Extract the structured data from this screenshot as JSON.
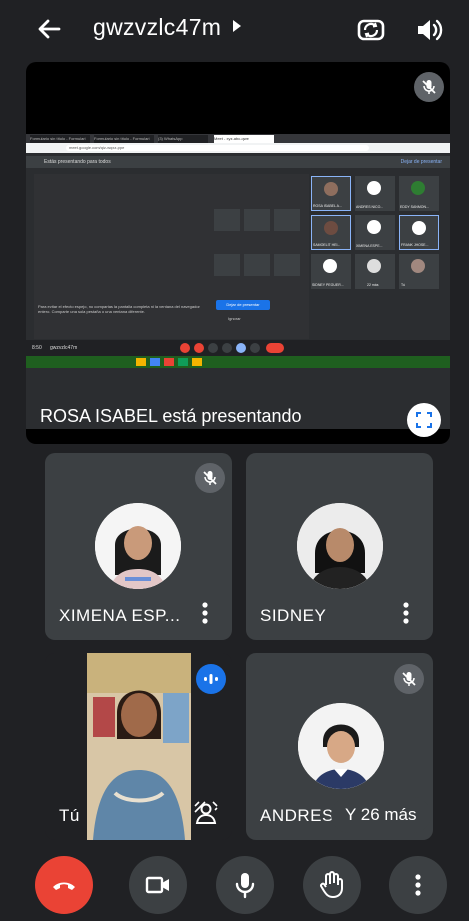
{
  "header": {
    "meeting_code": "gwzvzlc47m",
    "back_icon": "arrow-left-icon",
    "switch_camera_icon": "switch-camera-icon",
    "speaker_icon": "speaker-icon"
  },
  "presentation": {
    "caption": "ROSA ISABEL está presentando",
    "shared_screen": {
      "browser_tabs": [
        "Formulario sin título - Formulari",
        "Formulario sin título - Formulari",
        "(3) WhatsApp",
        "Meet - xyz-abc-qwe"
      ],
      "url": "meet.google.com/qiz-wqxz-ppe",
      "banner": "Estás presentando para todos",
      "stop_link": "Dejar de presentar",
      "warning": "Para evitar el efecto espejo, no compartas la pantalla completa ni la ventana del navegador entero. Comparte una sola pestaña o una ventana diferente.",
      "stop_button": "Dejar de presentar",
      "ignore": "Ignorar",
      "time": "8:50",
      "code": "gwzvzlc47m",
      "participants": [
        "ROSA ISABEL A...",
        "ANDRES NICO...",
        "EDDY SANMON...",
        "SAMOELIT HEI...",
        "XIMENA ESPE...",
        "FRANK JHOSE...",
        "SIDNEY PEGUER...",
        "22 más",
        "Tú"
      ]
    }
  },
  "tiles": [
    {
      "name": "XIMENA ESP..."
    },
    {
      "name": "SIDNEY"
    },
    {
      "name": "Tú"
    },
    {
      "name": "ANDRES NICOLÁS"
    }
  ],
  "more_participants": "Y 26 más",
  "controls": {
    "end_call_icon": "phone-hangup-icon",
    "camera_icon": "video-camera-icon",
    "mic_icon": "microphone-icon",
    "hand_icon": "raise-hand-icon",
    "more_icon": "more-vertical-icon"
  },
  "colors": {
    "end_call": "#ea4335",
    "speaking": "#1a73e8",
    "background": "#202124",
    "tile": "#3c4043"
  }
}
